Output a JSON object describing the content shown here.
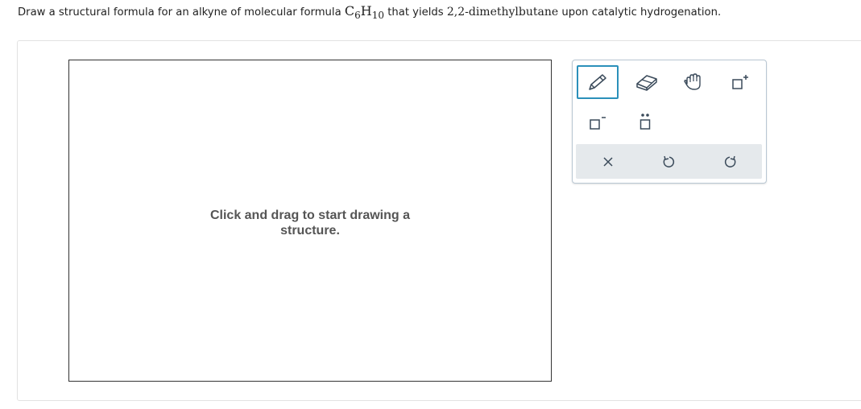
{
  "question": {
    "prefix": "Draw a structural formula for an alkyne of molecular formula",
    "formula_c": "C",
    "formula_c_sub": "6",
    "formula_h": "H",
    "formula_h_sub": "10",
    "middle": "that yields",
    "compound": "2,2-dimethylbutane",
    "suffix": "upon catalytic hydrogenation."
  },
  "canvas": {
    "hint_line1": "Click and drag to start drawing a",
    "hint_line2": "structure."
  },
  "toolbox": {
    "tools": [
      {
        "name": "pencil-icon"
      },
      {
        "name": "eraser-icon"
      },
      {
        "name": "hand-icon"
      },
      {
        "name": "positive-charge-icon"
      },
      {
        "name": "negative-charge-icon"
      },
      {
        "name": "lone-pair-icon"
      }
    ],
    "actions": [
      {
        "name": "clear-icon"
      },
      {
        "name": "undo-icon"
      },
      {
        "name": "redo-icon"
      }
    ]
  },
  "colors": {
    "accent": "#2b90ba",
    "icon": "#3a4a5a",
    "bar": "#e5e9ec"
  }
}
